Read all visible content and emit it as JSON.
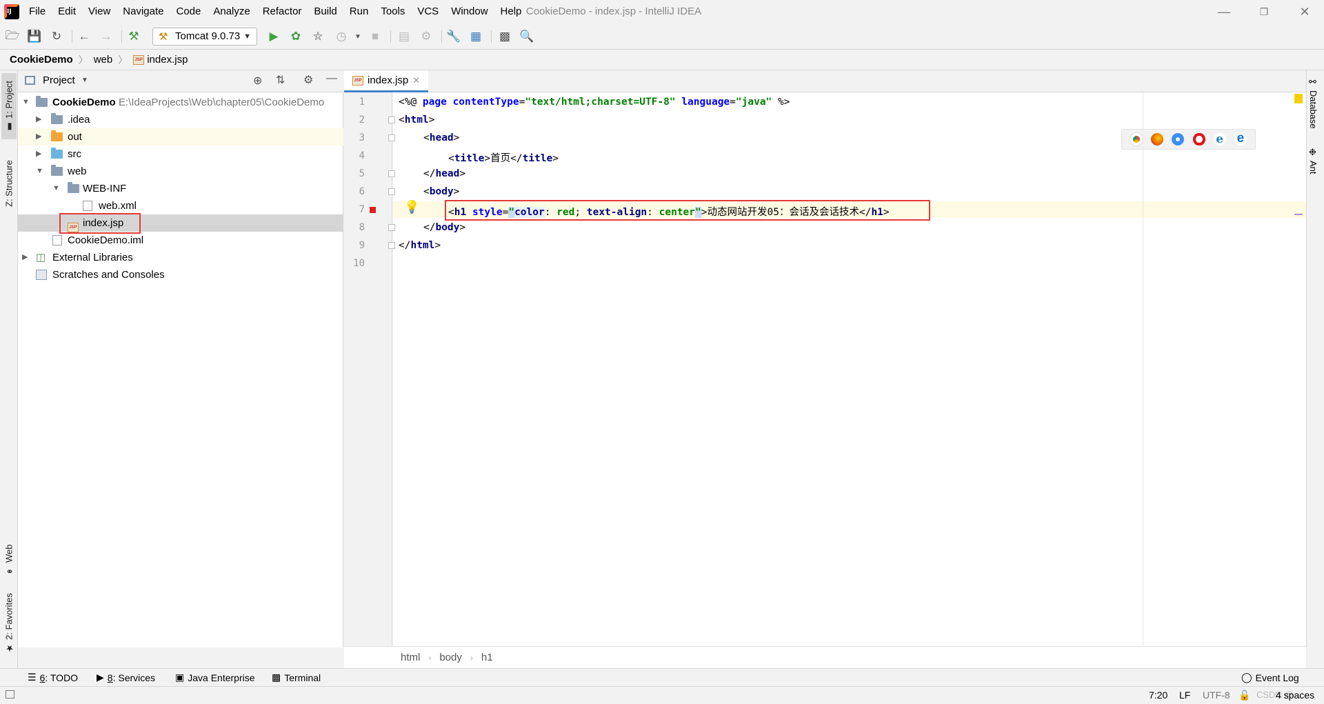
{
  "titlebar": {
    "title": "CookieDemo - index.jsp - IntelliJ IDEA",
    "menu": [
      "File",
      "Edit",
      "View",
      "Navigate",
      "Code",
      "Analyze",
      "Refactor",
      "Build",
      "Run",
      "Tools",
      "VCS",
      "Window",
      "Help"
    ]
  },
  "toolbar": {
    "run_config": "Tomcat 9.0.73"
  },
  "navbar": {
    "crumbs": [
      "CookieDemo",
      "web",
      "index.jsp"
    ]
  },
  "left_strip": {
    "project": "1: Project",
    "structure": "Z: Structure",
    "web": "Web",
    "favorites": "2: Favorites"
  },
  "right_strip": {
    "database": "Database",
    "ant": "Ant"
  },
  "project_panel": {
    "title": "Project",
    "root_name": "CookieDemo",
    "root_path": "E:\\IdeaProjects\\Web\\chapter05\\CookieDemo",
    "items": {
      "idea": ".idea",
      "out": "out",
      "src": "src",
      "web": "web",
      "webinf": "WEB-INF",
      "webxml": "web.xml",
      "indexjsp": "index.jsp",
      "iml": "CookieDemo.iml",
      "extlib": "External Libraries",
      "scratches": "Scratches and Consoles"
    }
  },
  "editor": {
    "tab": "index.jsp",
    "line_numbers": [
      "1",
      "2",
      "3",
      "4",
      "5",
      "6",
      "7",
      "8",
      "9",
      "10"
    ],
    "code": {
      "l1_open": "<%@ ",
      "l1_page": "page",
      "l1_ct": "contentType",
      "l1_eq": "=",
      "l1_ctv": "\"text/html;charset=UTF-8\"",
      "l1_lang": "language",
      "l1_eq2": "=",
      "l1_langv": "\"java\"",
      "l1_close": " %>",
      "l2_lt": "<",
      "l2_tag": "html",
      "l2_gt": ">",
      "l3_lt": "<",
      "l3_tag": "head",
      "l3_gt": ">",
      "l4_lt": "<",
      "l4_tag": "title",
      "l4_gt": ">",
      "l4_text": "首页",
      "l4_clt": "</",
      "l4_ctag": "title",
      "l4_cgt": ">",
      "l5_lt": "</",
      "l5_tag": "head",
      "l5_gt": ">",
      "l6_lt": "<",
      "l6_tag": "body",
      "l6_gt": ">",
      "l7_lt": "<",
      "l7_tag": "h1",
      "l7_attr": "style",
      "l7_eq": "=",
      "l7_q1": "\"",
      "l7_p1": "color",
      "l7_c1": ": ",
      "l7_v1": "red",
      "l7_semi": "; ",
      "l7_p2": "text-align",
      "l7_c2": ": ",
      "l7_v2": "center",
      "l7_q2": "\"",
      "l7_gt": ">",
      "l7_text": "动态网站开发05：会话及会话技术",
      "l7_clt": "</",
      "l7_ctag": "h1",
      "l7_cgt": ">",
      "l8_lt": "</",
      "l8_tag": "body",
      "l8_gt": ">",
      "l9_lt": "</",
      "l9_tag": "html",
      "l9_gt": ">"
    },
    "breadcrumb": [
      "html",
      "body",
      "h1"
    ]
  },
  "tool_tabs": {
    "todo_num": "6",
    "todo": ": TODO",
    "services_num": "8",
    "services": ": Services",
    "java_ee": "Java Enterprise",
    "terminal": "Terminal",
    "event_log": "Event Log"
  },
  "statusbar": {
    "position": "7:20",
    "line_sep": "LF",
    "encoding": "UTF-8",
    "indent": "4 spaces",
    "watermark": "CSDN @..."
  },
  "colors": {
    "accent": "#4083c9",
    "highlight_box": "#e53935",
    "current_line": "#fffae3",
    "run_green": "#59a869"
  }
}
